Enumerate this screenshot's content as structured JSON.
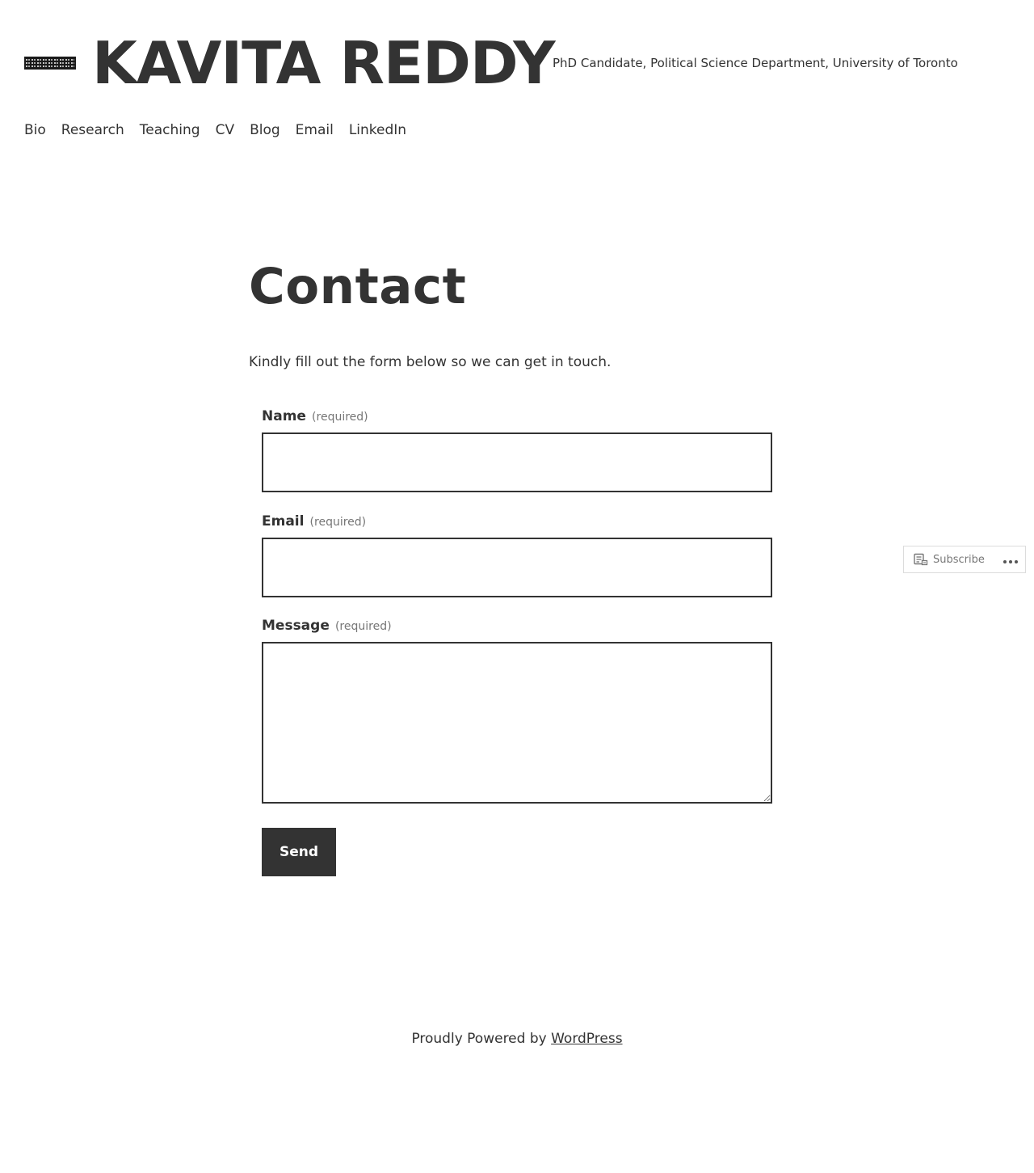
{
  "site": {
    "title": "KAVITA REDDY",
    "tagline": "PhD Candidate, Political Science Department, University of Toronto"
  },
  "nav": {
    "items": [
      "Bio",
      "Research",
      "Teaching",
      "CV",
      "Blog",
      "Email",
      "LinkedIn"
    ]
  },
  "page": {
    "title": "Contact",
    "intro": "Kindly fill out the form below so we can get in touch."
  },
  "form": {
    "name": {
      "label": "Name",
      "required": "(required)",
      "value": ""
    },
    "email": {
      "label": "Email",
      "required": "(required)",
      "value": ""
    },
    "message": {
      "label": "Message",
      "required": "(required)",
      "value": ""
    },
    "submit_label": "Send"
  },
  "footer": {
    "prefix": "Proudly Powered by",
    "link_label": "WordPress"
  },
  "subscribe": {
    "label": "Subscribe",
    "icon": "reader-icon",
    "more_icon": "more-horizontal-icon"
  },
  "colors": {
    "text": "#333333",
    "muted": "#767676",
    "button_bg": "#333333",
    "button_text": "#ffffff",
    "background": "#ffffff"
  }
}
